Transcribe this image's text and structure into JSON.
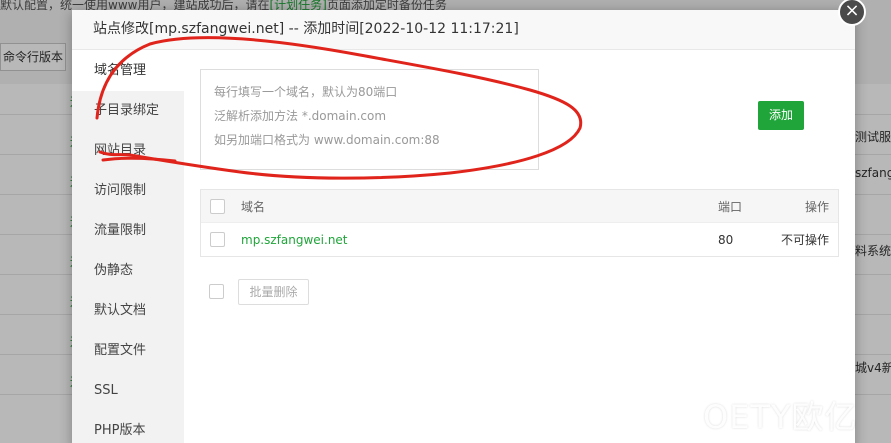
{
  "background": {
    "notice_prefix": "默认配置，统一使用www用户，建站成功后，请在",
    "notice_link": "[计划任务]",
    "notice_suffix": "页面添加定时备份任务",
    "cmd_button": "命令行版本",
    "right_fragments": [
      "测试服",
      "szfang",
      "料系统",
      "城v4新"
    ],
    "marks": [
      "运",
      "运",
      "运",
      "运",
      "运",
      "运",
      "运",
      "运"
    ]
  },
  "modal": {
    "title": "站点修改[mp.szfangwei.net] -- 添加时间[2022-10-12 11:17:21]",
    "close_symbol": "×",
    "nav": [
      "域名管理",
      "子目录绑定",
      "网站目录",
      "访问限制",
      "流量限制",
      "伪静态",
      "默认文档",
      "配置文件",
      "SSL",
      "PHP版本"
    ],
    "active_nav_index": 0,
    "textarea": {
      "line1": "每行填写一个域名，默认为80端口",
      "line2": "泛解析添加方法 *.domain.com",
      "line3": "如另加端口格式为 www.domain.com:88"
    },
    "add_button": "添加",
    "table": {
      "headers": {
        "domain": "域名",
        "port": "端口",
        "action": "操作"
      },
      "rows": [
        {
          "domain": "mp.szfangwei.net",
          "port": "80",
          "action": "不可操作"
        }
      ]
    },
    "batch_delete": "批量删除"
  },
  "watermark": "OETY欧亿",
  "colors": {
    "accent": "#20a53a",
    "annotation": "#e0241c"
  }
}
